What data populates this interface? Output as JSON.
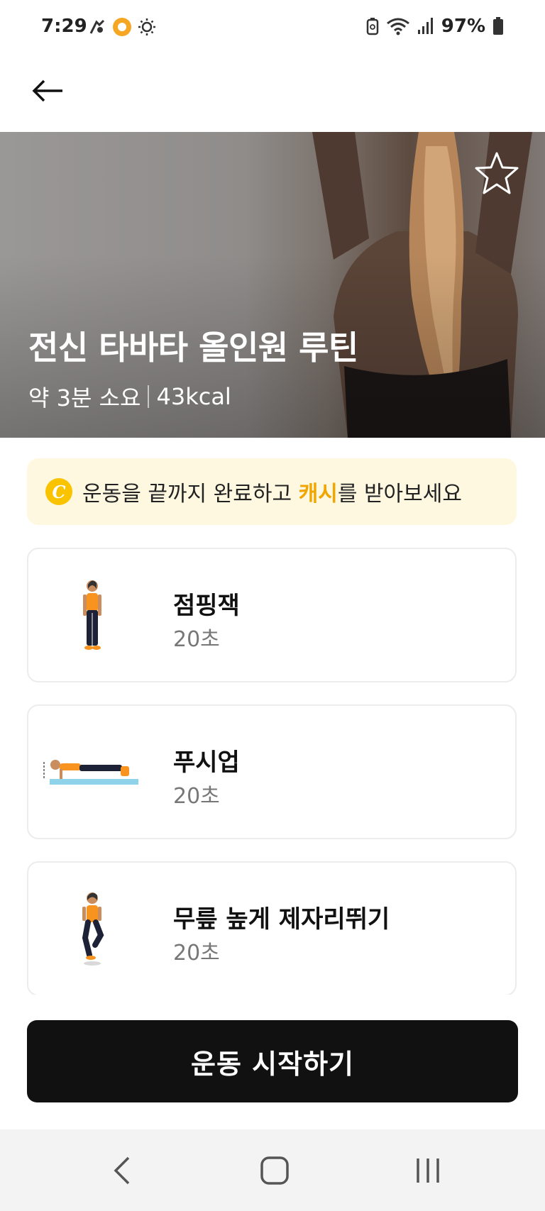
{
  "status_bar": {
    "time": "7:29",
    "battery": "97%",
    "left_icons": [
      "fitness-notification-icon",
      "app-notification-icon",
      "brightness-icon"
    ],
    "right_icons": [
      "battery-saver-icon",
      "wifi-icon",
      "signal-icon",
      "battery-icon"
    ]
  },
  "header": {
    "back_icon": "arrow-left-icon"
  },
  "hero": {
    "title": "전신 타바타 올인원 루틴",
    "duration": "약 3분 소요",
    "calories": "43kcal",
    "favorite_icon": "star-icon"
  },
  "cash_banner": {
    "coin_letter": "C",
    "text_before": "운동을 끝까지 완료하고 ",
    "highlight": "캐시",
    "text_after": "를 받아보세요",
    "highlight_color": "#f0a500"
  },
  "exercises": [
    {
      "name": "점핑잭",
      "duration": "20초",
      "icon": "standing-figure-icon"
    },
    {
      "name": "푸시업",
      "duration": "20초",
      "icon": "pushup-figure-icon"
    },
    {
      "name": "무릎 높게 제자리뛰기",
      "duration": "20초",
      "icon": "high-knees-figure-icon"
    }
  ],
  "start_button": {
    "label": "운동 시작하기"
  },
  "nav_bar": {
    "icons": [
      "back-nav-icon",
      "home-nav-icon",
      "recents-nav-icon"
    ]
  },
  "colors": {
    "accent": "#f9c300",
    "button_bg": "#111111",
    "banner_bg": "#fff8e1"
  }
}
